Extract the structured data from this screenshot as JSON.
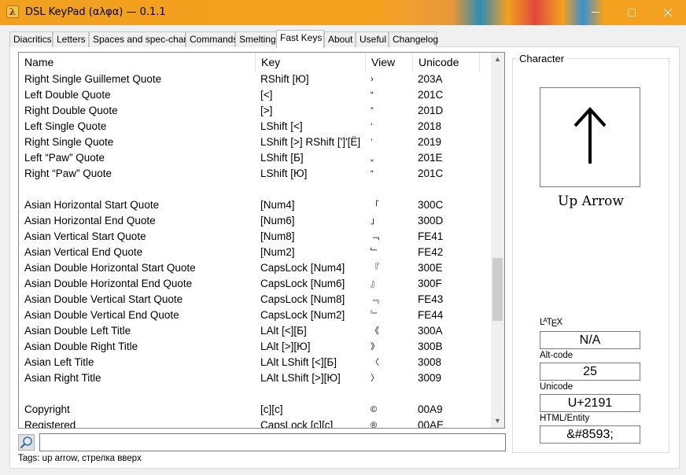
{
  "window": {
    "title": "DSL KeyPad (αλφα)  —  0.1.1",
    "app_icon_glyph": "λ"
  },
  "tabs": [
    {
      "label": "Diacritics"
    },
    {
      "label": "Letters"
    },
    {
      "label": "Spaces and spec-chars"
    },
    {
      "label": "Commands"
    },
    {
      "label": "Smelting"
    },
    {
      "label": "Fast Keys",
      "active": true
    },
    {
      "label": "About"
    },
    {
      "label": "Useful"
    },
    {
      "label": "Changelog"
    }
  ],
  "list": {
    "columns": {
      "name": "Name",
      "key": "Key",
      "view": "View",
      "unicode": "Unicode"
    },
    "rows": [
      {
        "name": "Right Single Guillemet Quote",
        "key": "RShift [Ю]",
        "view": "›",
        "unicode": "203A"
      },
      {
        "name": "Left Double Quote",
        "key": "[<]",
        "view": "“",
        "unicode": "201C"
      },
      {
        "name": "Right Double Quote",
        "key": "[>]",
        "view": "”",
        "unicode": "201D"
      },
      {
        "name": "Left Single Quote",
        "key": "LShift [<]",
        "view": "‘",
        "unicode": "2018"
      },
      {
        "name": "Right Single Quote",
        "key": "LShift [>] RShift [']'[Ё]",
        "view": "’",
        "unicode": "2019"
      },
      {
        "name": "Left “Paw” Quote",
        "key": "LShift [Б]",
        "view": "„",
        "unicode": "201E"
      },
      {
        "name": "Right “Paw” Quote",
        "key": "LShift [Ю]",
        "view": "“",
        "unicode": "201C"
      },
      {
        "name": "",
        "key": "",
        "view": "",
        "unicode": ""
      },
      {
        "name": "Asian Horizontal Start Quote",
        "key": "[Num4]",
        "view": "「",
        "unicode": "300C"
      },
      {
        "name": "Asian Horizontal End Quote",
        "key": "[Num6]",
        "view": "」",
        "unicode": "300D"
      },
      {
        "name": "Asian Vertical Start Quote",
        "key": "[Num8]",
        "view": "﹁",
        "unicode": "FE41"
      },
      {
        "name": "Asian Vertical End Quote",
        "key": "[Num2]",
        "view": "﹂",
        "unicode": "FE42"
      },
      {
        "name": "Asian Double Horizontal Start Quote",
        "key": "CapsLock [Num4]",
        "view": "『",
        "unicode": "300E"
      },
      {
        "name": "Asian Double Horizontal End Quote",
        "key": "CapsLock [Num6]",
        "view": "』",
        "unicode": "300F"
      },
      {
        "name": "Asian Double Vertical Start Quote",
        "key": "CapsLock [Num8]",
        "view": "﹃",
        "unicode": "FE43"
      },
      {
        "name": "Asian Double Vertical End Quote",
        "key": "CapsLock [Num2]",
        "view": "﹄",
        "unicode": "FE44"
      },
      {
        "name": "Asian Double Left Title",
        "key": "LAlt [<][Б]",
        "view": "《",
        "unicode": "300A"
      },
      {
        "name": "Asian Double Right Title",
        "key": "LAlt [>][Ю]",
        "view": "》",
        "unicode": "300B"
      },
      {
        "name": "Asian Left Title",
        "key": "LAlt LShift [<][Б]",
        "view": "〈",
        "unicode": "3008"
      },
      {
        "name": "Asian Right Title",
        "key": "LAlt LShift [>][Ю]",
        "view": "〉",
        "unicode": "3009"
      },
      {
        "name": "",
        "key": "",
        "view": "",
        "unicode": ""
      },
      {
        "name": "Copyright",
        "key": "[c][c]",
        "view": "©",
        "unicode": "00A9"
      },
      {
        "name": "Registered",
        "key": "CapsLock [c][c]",
        "view": "®",
        "unicode": "00AE"
      }
    ]
  },
  "search": {
    "value": "",
    "icon": "magnifier-icon"
  },
  "tags_text": "Tags: up arrow, стрелка вверх",
  "character": {
    "group_title": "Character",
    "glyph": "↑",
    "name": "Up Arrow",
    "latex_label": "LaTeX",
    "latex_value": "N/A",
    "altcode_label": "Alt-code",
    "altcode_value": "25",
    "unicode_label": "Unicode",
    "unicode_value": "U+2191",
    "html_label": "HTML/Entity",
    "html_value": "&#8593;"
  }
}
